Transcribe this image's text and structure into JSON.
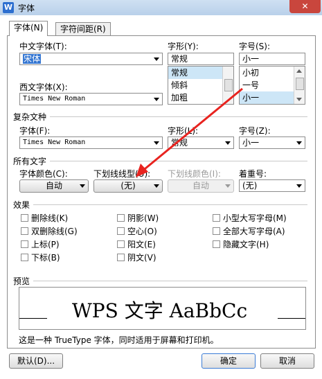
{
  "window": {
    "title": "字体",
    "app_icon": "W",
    "close_glyph": "✕"
  },
  "tabs": [
    {
      "label": "字体(N)",
      "active": true
    },
    {
      "label": "字符间距(R)",
      "active": false
    }
  ],
  "chinese_font": {
    "label": "中文字体(T):",
    "value": "宋体"
  },
  "style": {
    "label": "字形(Y):",
    "value": "常规",
    "options": [
      "常规",
      "倾斜",
      "加粗"
    ],
    "selected": "常规"
  },
  "size": {
    "label": "字号(S):",
    "value": "小一",
    "options": [
      "小初",
      "一号",
      "小一"
    ],
    "selected": "小一"
  },
  "western_font": {
    "label": "西文字体(X):",
    "value": "Times New Roman"
  },
  "complex": {
    "section": "复杂文种",
    "font_label": "字体(F):",
    "font_value": "Times New Roman",
    "style_label": "字形(L):",
    "style_value": "常规",
    "size_label": "字号(Z):",
    "size_value": "小一"
  },
  "all_text": {
    "section": "所有文字",
    "color_label": "字体颜色(C):",
    "color_value": "自动",
    "underline_label": "下划线线型(U):",
    "underline_value": "(无)",
    "underline_color_label": "下划线颜色(I):",
    "underline_color_value": "自动",
    "emphasis_label": "着重号:",
    "emphasis_value": "(无)"
  },
  "effects": {
    "section": "效果",
    "items": [
      "删除线(K)",
      "双删除线(G)",
      "上标(P)",
      "下标(B)",
      "阴影(W)",
      "空心(O)",
      "阳文(E)",
      "阴文(V)",
      "小型大写字母(M)",
      "全部大写字母(A)",
      "隐藏文字(H)"
    ]
  },
  "preview": {
    "section": "预览",
    "sample": "WPS 文字 AaBbCc",
    "note": "这是一种 TrueType 字体，同时适用于屏幕和打印机。"
  },
  "buttons": {
    "default": "默认(D)...",
    "ok": "确定",
    "cancel": "取消"
  },
  "colors": {
    "annotation_red": "#e8231f",
    "selection_blue": "#cde6f7",
    "close_red": "#c9463d"
  }
}
